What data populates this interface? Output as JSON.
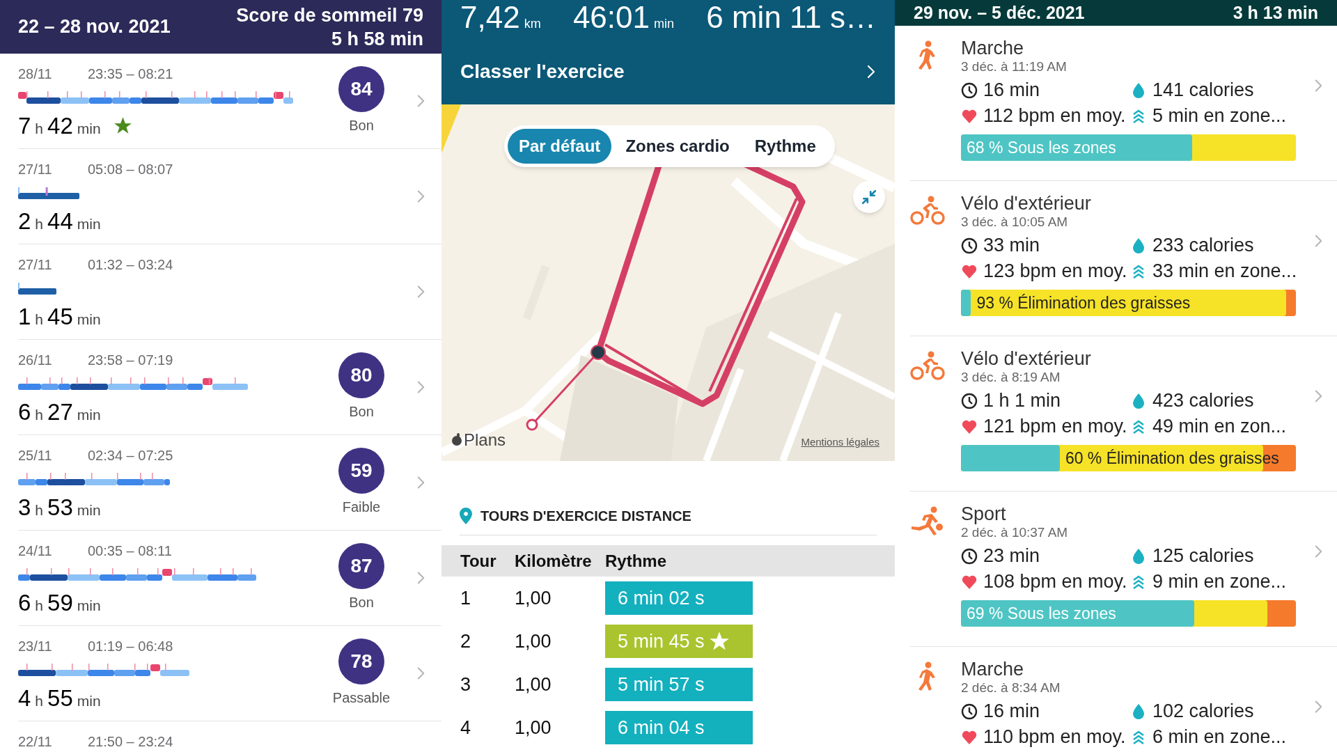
{
  "sleep_panel": {
    "header": {
      "week": "22 – 28 nov. 2021",
      "score": "Score de sommeil 79",
      "average": "5 h 58 min"
    },
    "nights": [
      {
        "date": "28/11",
        "time": "23:35 – 08:21",
        "duration": [
          {
            "kind": "number",
            "text": "7"
          },
          {
            "kind": "unit",
            "text": "h"
          },
          {
            "kind": "number",
            "text": "42"
          },
          {
            "kind": "unit",
            "text": "min"
          }
        ],
        "starred": true,
        "score": {
          "value": "84",
          "label": "Bon"
        }
      },
      {
        "date": "27/11",
        "time": "05:08 – 08:07",
        "duration": [
          {
            "kind": "number",
            "text": "2"
          },
          {
            "kind": "unit",
            "text": "h"
          },
          {
            "kind": "number",
            "text": "44"
          },
          {
            "kind": "unit",
            "text": "min"
          }
        ],
        "starred": false
      },
      {
        "date": "27/11",
        "time": "01:32 – 03:24",
        "duration": [
          {
            "kind": "number",
            "text": "1"
          },
          {
            "kind": "unit",
            "text": "h"
          },
          {
            "kind": "number",
            "text": "45"
          },
          {
            "kind": "unit",
            "text": "min"
          }
        ],
        "starred": false
      },
      {
        "date": "26/11",
        "time": "23:58 – 07:19",
        "duration": [
          {
            "kind": "number",
            "text": "6"
          },
          {
            "kind": "unit",
            "text": "h"
          },
          {
            "kind": "number",
            "text": "27"
          },
          {
            "kind": "unit",
            "text": "min"
          }
        ],
        "starred": false,
        "score": {
          "value": "80",
          "label": "Bon"
        }
      },
      {
        "date": "25/11",
        "time": "02:34 – 07:25",
        "duration": [
          {
            "kind": "number",
            "text": "3"
          },
          {
            "kind": "unit",
            "text": "h"
          },
          {
            "kind": "number",
            "text": "53"
          },
          {
            "kind": "unit",
            "text": "min"
          }
        ],
        "starred": false,
        "score": {
          "value": "59",
          "label": "Faible"
        }
      },
      {
        "date": "24/11",
        "time": "00:35 – 08:11",
        "duration": [
          {
            "kind": "number",
            "text": "6"
          },
          {
            "kind": "unit",
            "text": "h"
          },
          {
            "kind": "number",
            "text": "59"
          },
          {
            "kind": "unit",
            "text": "min"
          }
        ],
        "starred": false,
        "score": {
          "value": "87",
          "label": "Bon"
        }
      },
      {
        "date": "23/11",
        "time": "01:19 – 06:48",
        "duration": [
          {
            "kind": "number",
            "text": "4"
          },
          {
            "kind": "unit",
            "text": "h"
          },
          {
            "kind": "number",
            "text": "55"
          },
          {
            "kind": "unit",
            "text": "min"
          }
        ],
        "starred": false,
        "score": {
          "value": "78",
          "label": "Passable"
        }
      },
      {
        "date": "22/11",
        "time": "21:50 – 23:24",
        "starred": false
      }
    ]
  },
  "exercise_panel": {
    "stats": [
      {
        "value": "7,42",
        "unit": "km"
      },
      {
        "value": "46:01",
        "unit": "min"
      },
      {
        "value": "6 min 11 s…"
      }
    ],
    "classify": "Classer l'exercice",
    "map": {
      "kind": "picture",
      "tabs": [
        {
          "label": "Par défaut",
          "selected": true
        },
        {
          "label": "Zones cardio",
          "selected": false
        },
        {
          "label": "Rythme",
          "selected": false
        }
      ],
      "attribution": "Plans",
      "legal": "Mentions légales"
    },
    "laps": {
      "title": "TOURS D'EXERCICE DISTANCE",
      "columns": [
        "Tour",
        "Kilomètre",
        "Rythme"
      ],
      "rows": [
        {
          "lap": "1",
          "km": "1,00",
          "pace": "6 min 02 s",
          "best": false
        },
        {
          "lap": "2",
          "km": "1,00",
          "pace": "5 min 45 s",
          "best": true
        },
        {
          "lap": "3",
          "km": "1,00",
          "pace": "5 min 57 s",
          "best": false
        },
        {
          "lap": "4",
          "km": "1,00",
          "pace": "6 min 04 s",
          "best": false
        }
      ]
    }
  },
  "activity_panel": {
    "header": {
      "week": "29 nov. – 5 déc. 2021",
      "total": "3 h 13 min"
    },
    "activities": [
      {
        "kind": "walk",
        "title": "Marche",
        "date": "3 déc. à 11:19 AM",
        "duration": "16 min",
        "calories": "141 calories",
        "heart_rate": "112 bpm en moy.",
        "zone_minutes": "5 min en zone...",
        "fills": [
          {
            "color": "#4ec5c4",
            "level": 0.69,
            "label": "68 % Sous les zones"
          },
          {
            "color": "#f6e227"
          }
        ]
      },
      {
        "kind": "bike",
        "title": "Vélo d'extérieur",
        "date": "3 déc. à 10:05 AM",
        "duration": "33 min",
        "calories": "233 calories",
        "heart_rate": "123 bpm en moy.",
        "zone_minutes": "33 min en zone...",
        "fills": [
          {
            "color": "#4ec5c4",
            "level": 0.03
          },
          {
            "color": "#f6e227",
            "level": 0.97,
            "label": "93 % Élimination des graisses"
          },
          {
            "color": "#f57a2b"
          }
        ]
      },
      {
        "kind": "bike",
        "title": "Vélo d'extérieur",
        "date": "3 déc. à 8:19 AM",
        "duration": "1 h 1 min",
        "calories": "423 calories",
        "heart_rate": "121 bpm en moy.",
        "zone_minutes": "49 min en zon...",
        "fills": [
          {
            "color": "#4ec5c4",
            "level": 0.295
          },
          {
            "color": "#f6e227",
            "level": 0.902,
            "label": "60 % Élimination des graisses"
          },
          {
            "color": "#f57a2b"
          }
        ]
      },
      {
        "kind": "sport",
        "title": "Sport",
        "date": "2 déc. à 10:37 AM",
        "duration": "23 min",
        "calories": "125 calories",
        "heart_rate": "108 bpm en moy.",
        "zone_minutes": "9 min en zone...",
        "fills": [
          {
            "color": "#4ec5c4",
            "level": 0.697,
            "label": "69 % Sous les zones"
          },
          {
            "color": "#f6e227",
            "level": 0.915
          },
          {
            "color": "#f57a2b"
          }
        ]
      },
      {
        "kind": "walk",
        "title": "Marche",
        "date": "2 déc. à 8:34 AM",
        "duration": "16 min",
        "calories": "102 calories",
        "heart_rate": "110 bpm en moy.",
        "zone_minutes": "6 min en zone..."
      }
    ]
  }
}
